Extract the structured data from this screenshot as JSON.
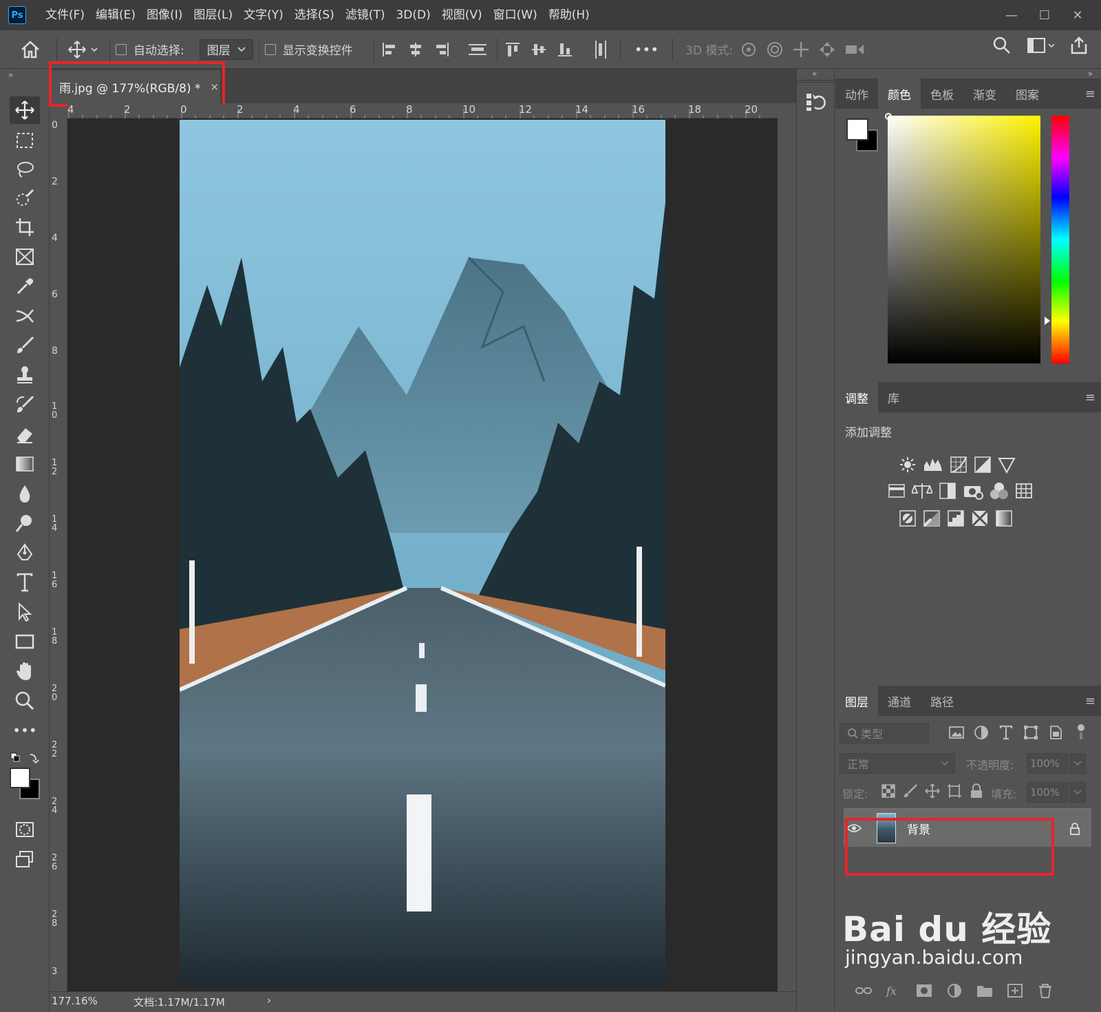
{
  "app": {
    "logo": "Ps"
  },
  "menu": [
    "文件(F)",
    "编辑(E)",
    "图像(I)",
    "图层(L)",
    "文字(Y)",
    "选择(S)",
    "滤镜(T)",
    "3D(D)",
    "视图(V)",
    "窗口(W)",
    "帮助(H)"
  ],
  "window": {
    "minimize": "—",
    "maximize": "☐",
    "close": "✕"
  },
  "options": {
    "auto_select_label": "自动选择:",
    "layer_dropdown": "图层",
    "show_transform_label": "显示变换控件",
    "more": "•••",
    "mode_3d_label": "3D 模式:"
  },
  "document": {
    "tab_title": "雨.jpg @ 177%(RGB/8) *",
    "close": "×"
  },
  "ruler": {
    "top": [
      "4",
      "2",
      "0",
      "2",
      "4",
      "6",
      "8",
      "10",
      "12",
      "14",
      "16",
      "18",
      "20"
    ],
    "left": [
      "0",
      "2",
      "4",
      "6",
      "8",
      "10",
      "12",
      "14",
      "16",
      "18",
      "20",
      "22",
      "24",
      "26",
      "28",
      "3"
    ]
  },
  "status": {
    "zoom": "177.16%",
    "doc_size": "文档:1.17M/1.17M",
    "arrow": "›"
  },
  "panel_color": {
    "tabs": [
      "动作",
      "颜色",
      "色板",
      "渐变",
      "图案"
    ],
    "active": "颜色"
  },
  "panel_adjust": {
    "tabs": [
      "调整",
      "库"
    ],
    "active": "调整",
    "add_label": "添加调整"
  },
  "panel_layers": {
    "tabs": [
      "图层",
      "通道",
      "路径"
    ],
    "active": "图层",
    "search_placeholder": "类型",
    "blend_mode": "正常",
    "opacity_label": "不透明度:",
    "opacity_value": "100%",
    "lock_label": "锁定:",
    "fill_label": "填充:",
    "fill_value": "100%",
    "layer_name": "背景"
  },
  "watermark": {
    "brand": "Bai du 经验",
    "url": "jingyan.baidu.com"
  },
  "colors": {
    "highlight": "#e8252a",
    "panel_bg": "#535353",
    "dark_bg": "#424242",
    "canvas_bg": "#2a2a2a"
  }
}
